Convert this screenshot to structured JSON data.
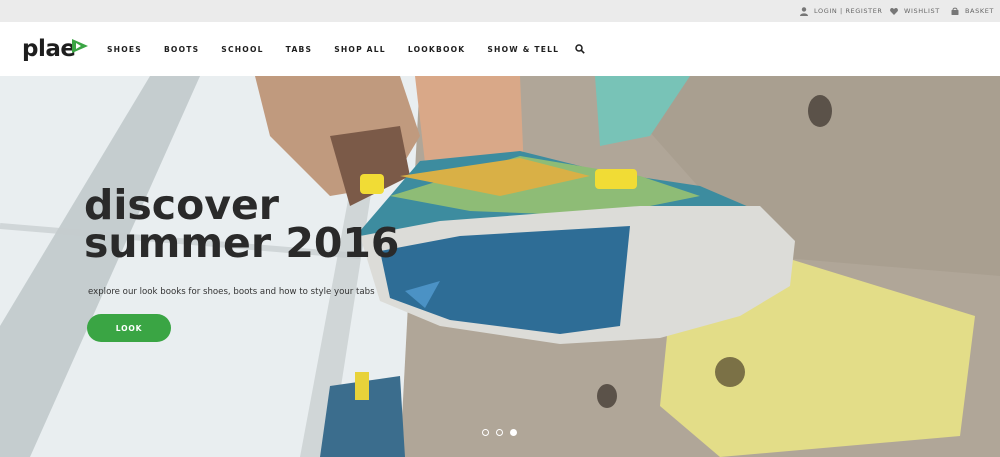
{
  "utility_bar": {
    "login": "LOGIN | REGISTER",
    "wishlist": "WISHLIST",
    "basket": "BASKET"
  },
  "header": {
    "logo_text": "plae",
    "brand_color": "#3aa544",
    "nav": [
      "SHOES",
      "BOOTS",
      "SCHOOL",
      "TABS",
      "SHOP ALL",
      "LOOKBOOK",
      "SHOW & TELL"
    ],
    "search_icon": "search-icon"
  },
  "hero": {
    "title_line1": "discover",
    "title_line2": "summer 2016",
    "subtitle": "explore our look books for shoes, boots and how to style your tabs",
    "cta_label": "LOOK",
    "cta_color": "#3aa544",
    "slides": 3,
    "active_slide": 3
  }
}
